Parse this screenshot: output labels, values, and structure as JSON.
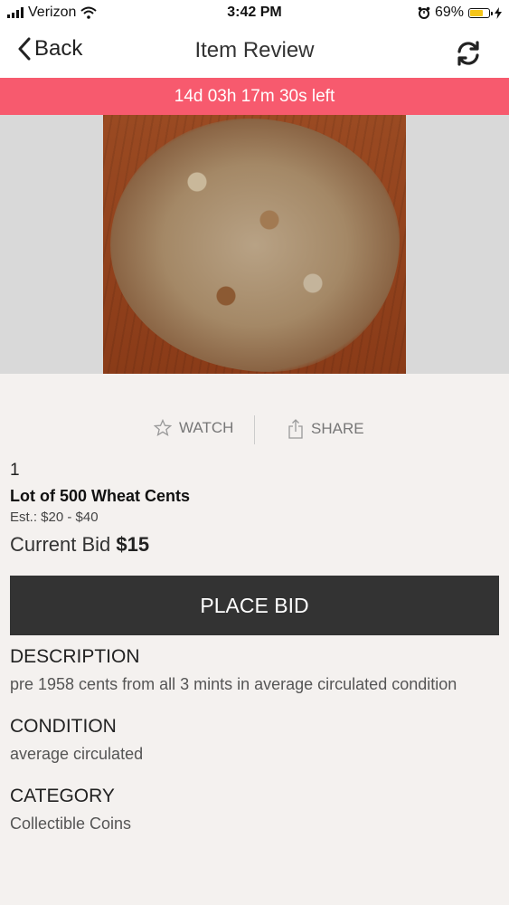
{
  "status_bar": {
    "carrier": "Verizon",
    "time": "3:42 PM",
    "battery_percent": "69%",
    "battery_level": 0.69,
    "battery_color": "#f5c518"
  },
  "nav": {
    "back_label": "Back",
    "title": "Item Review",
    "refresh_icon": "refresh-icon"
  },
  "timer": {
    "text": "14d 03h 17m 30s left",
    "color": "#f75a6e"
  },
  "actions": {
    "watch_label": "WATCH",
    "share_label": "SHARE"
  },
  "item": {
    "lot_number": "1",
    "title": "Lot of 500 Wheat Cents",
    "estimate": "Est.: $20 - $40",
    "current_bid_label": "Current Bid",
    "current_bid_value": "$15"
  },
  "place_bid_label": "PLACE BID",
  "sections": [
    {
      "heading": "DESCRIPTION",
      "text": "pre 1958 cents from all 3 mints in average circulated condition"
    },
    {
      "heading": "CONDITION",
      "text": "average circulated"
    },
    {
      "heading": "CATEGORY",
      "text": "Collectible Coins"
    }
  ]
}
